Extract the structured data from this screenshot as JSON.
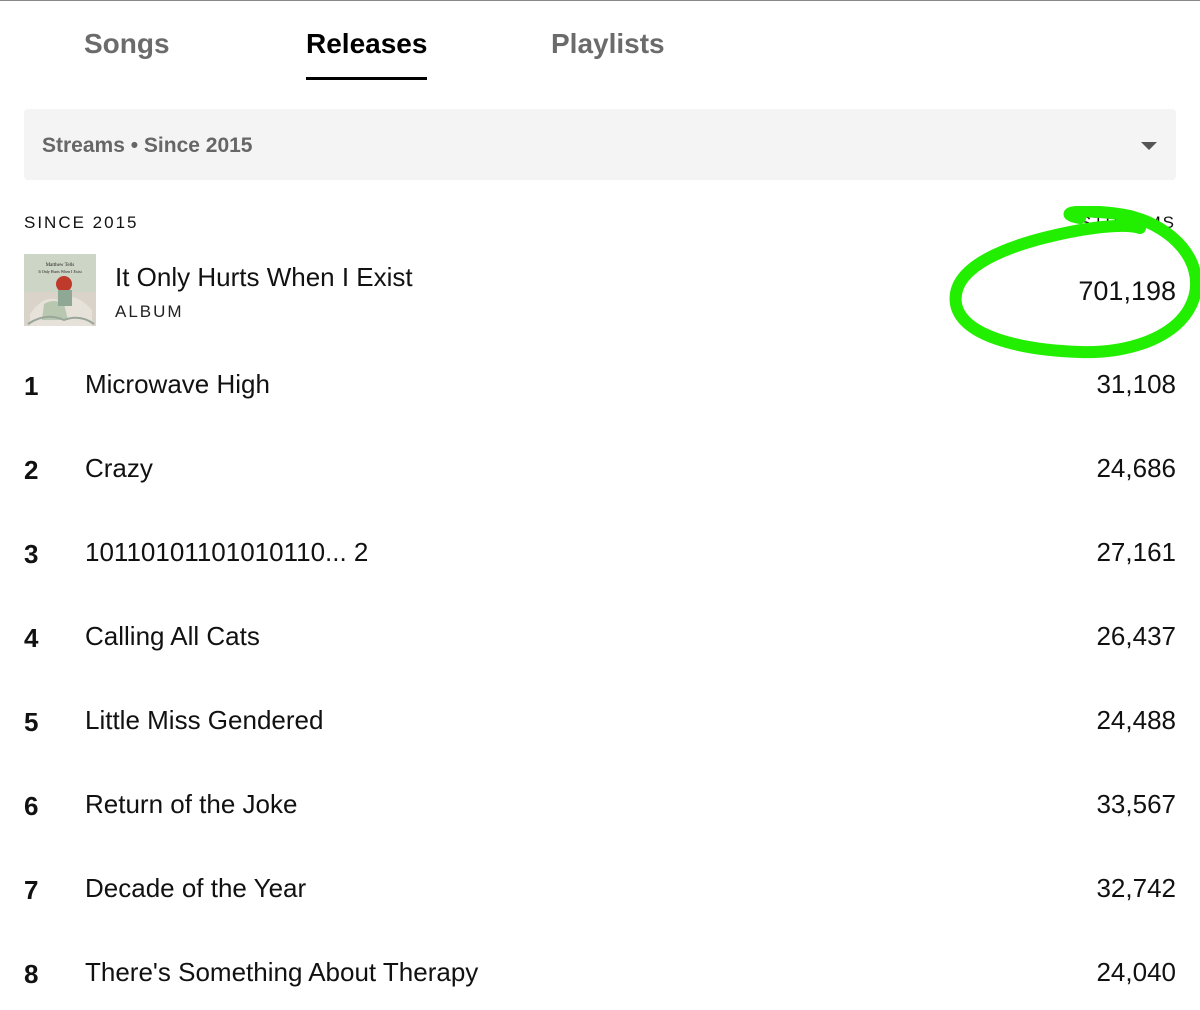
{
  "tabs": [
    {
      "label": "Songs",
      "active": false
    },
    {
      "label": "Releases",
      "active": true
    },
    {
      "label": "Playlists",
      "active": false
    }
  ],
  "filter": {
    "label": "Streams • Since 2015"
  },
  "list_header": {
    "period": "SINCE 2015",
    "metric": "STREAMS"
  },
  "release": {
    "title": "It Only Hurts When I Exist",
    "type": "ALBUM",
    "streams": "701,198",
    "cover_text": [
      "Matthew Tells",
      "It Only Hurts When I Exist"
    ]
  },
  "tracks": [
    {
      "num": "1",
      "title": "Microwave High",
      "streams": "31,108"
    },
    {
      "num": "2",
      "title": "Crazy",
      "streams": "24,686"
    },
    {
      "num": "3",
      "title": "10110101101010110... 2",
      "streams": "27,161"
    },
    {
      "num": "4",
      "title": "Calling All Cats",
      "streams": "26,437"
    },
    {
      "num": "5",
      "title": "Little Miss Gendered",
      "streams": "24,488"
    },
    {
      "num": "6",
      "title": "Return of the Joke",
      "streams": "33,567"
    },
    {
      "num": "7",
      "title": "Decade of the Year",
      "streams": "32,742"
    },
    {
      "num": "8",
      "title": "There's Something About Therapy",
      "streams": "24,040"
    }
  ],
  "colors": {
    "annotation": "#22ee00",
    "active_tab": "#000000",
    "inactive_tab": "#6b6b6b",
    "filter_bg": "#f4f4f4"
  }
}
